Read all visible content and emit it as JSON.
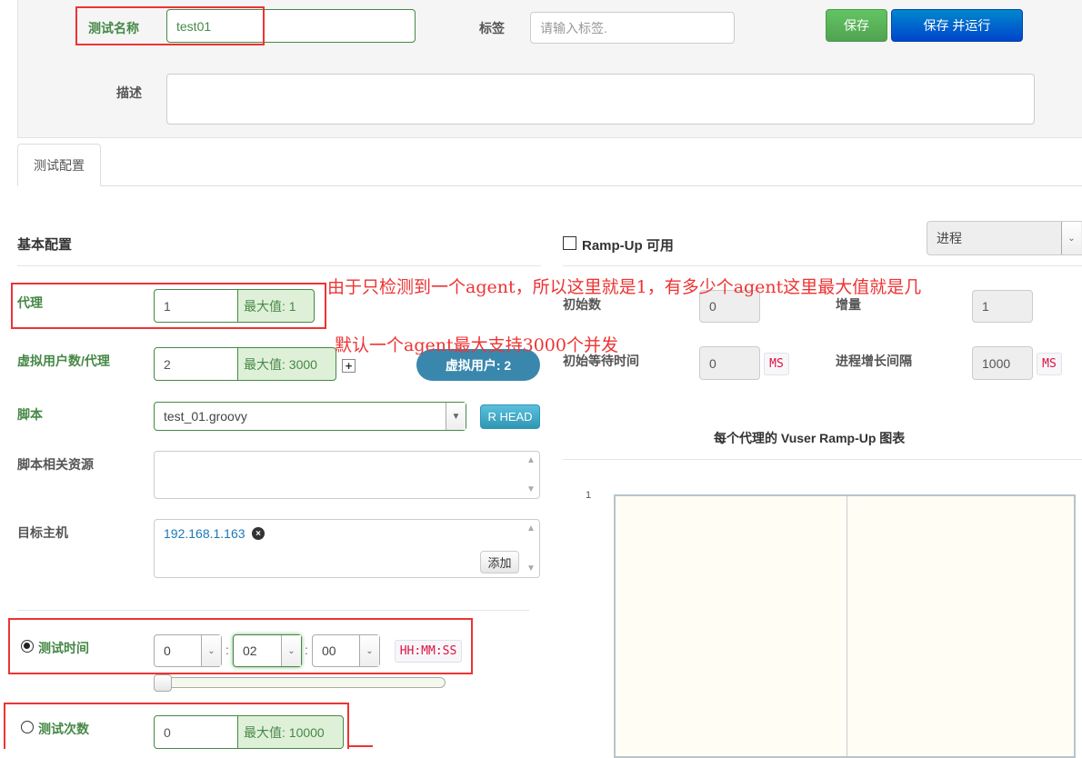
{
  "header": {
    "test_name_label": "测试名称",
    "test_name_value": "test01",
    "tag_label": "标签",
    "tag_placeholder": "请输入标签.",
    "save_button": "保存",
    "save_run_button": "保存 并运行",
    "desc_label": "描述"
  },
  "tabs": {
    "test_config": "测试配置"
  },
  "basic": {
    "section_title": "基本配置",
    "agent_label": "代理",
    "agent_value": "1",
    "agent_max": "最大值: 1",
    "vuser_label": "虚拟用户数/代理",
    "vuser_value": "2",
    "vuser_max": "最大值: 3000",
    "vuser_badge": "虚拟用户: 2",
    "script_label": "脚本",
    "script_value": "test_01.groovy",
    "rhead_button": "R HEAD",
    "resources_label": "脚本相关资源",
    "target_host_label": "目标主机",
    "target_host_ip": "192.168.1.163",
    "add_button": "添加",
    "duration_label": "测试时间",
    "duration_h": "0",
    "duration_m": "02",
    "duration_s": "00",
    "duration_format": "HH:MM:SS",
    "count_label": "测试次数",
    "count_value": "0",
    "count_max": "最大值: 10000"
  },
  "rampup": {
    "enable_label": "Ramp-Up 可用",
    "mode_value": "进程",
    "init_count_label": "初始数",
    "init_count_value": "0",
    "increment_label": "增量",
    "increment_value": "1",
    "init_wait_label": "初始等待时间",
    "init_wait_value": "0",
    "init_wait_unit": "MS",
    "interval_label": "进程增长间隔",
    "interval_value": "1000",
    "interval_unit": "MS",
    "chart_title": "每个代理的 Vuser Ramp-Up 图表",
    "chart_y_tick": "1"
  },
  "annotations": {
    "agent_note": "由于只检测到一个agent，所以这里就是1，有多少个agent这里最大值就是几",
    "vuser_note": "默认一个agent最大支持3000个并发"
  }
}
